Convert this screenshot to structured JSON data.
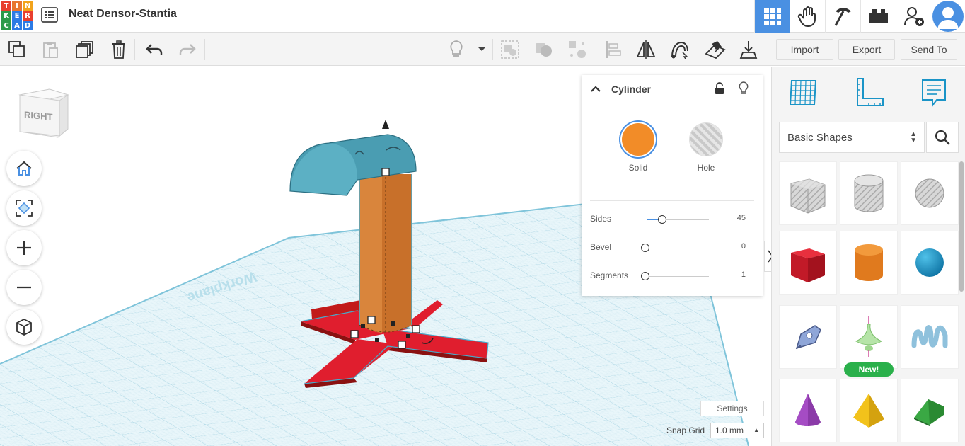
{
  "app": {
    "logo_letters": [
      "T",
      "I",
      "N",
      "K",
      "E",
      "R",
      "C",
      "A",
      "D"
    ],
    "logo_colors": [
      "#e83f2f",
      "#e8762f",
      "#f2a31b",
      "#2d9a4a",
      "#2c7be5",
      "#e83f2f",
      "#2d9a4a",
      "#2c7be5",
      "#2c7be5"
    ],
    "title": "Neat Densor-Stantia"
  },
  "topbar": {
    "icons": [
      "grid-view-icon",
      "hand-icon",
      "pickaxe-icon",
      "brick-icon",
      "add-user-icon",
      "user-avatar"
    ],
    "active": "grid-view-icon",
    "accent": "#4a90e2"
  },
  "toolbar": {
    "import_label": "Import",
    "export_label": "Export",
    "send_to_label": "Send To"
  },
  "viewcube": {
    "face_label": "RIGHT"
  },
  "workplane": {
    "label": "Workplane"
  },
  "inspector": {
    "title": "Cylinder",
    "solid_label": "Solid",
    "hole_label": "Hole",
    "solid_color": "#f28c28",
    "properties": [
      {
        "label": "Sides",
        "value": "45",
        "level": 0.27
      },
      {
        "label": "Bevel",
        "value": "0",
        "level": 0
      },
      {
        "label": "Segments",
        "value": "1",
        "level": 0
      }
    ]
  },
  "bottom": {
    "settings_label": "Settings",
    "snap_label": "Snap Grid",
    "snap_value": "1.0 mm"
  },
  "library": {
    "category": "Basic Shapes",
    "new_badge": "New!",
    "tiles": [
      "box-hole",
      "cylinder-hole",
      "sphere-hole",
      "box",
      "cylinder",
      "sphere",
      "scribble",
      "paraboloid",
      "text-3d",
      "cone",
      "pyramid",
      "roof"
    ]
  }
}
